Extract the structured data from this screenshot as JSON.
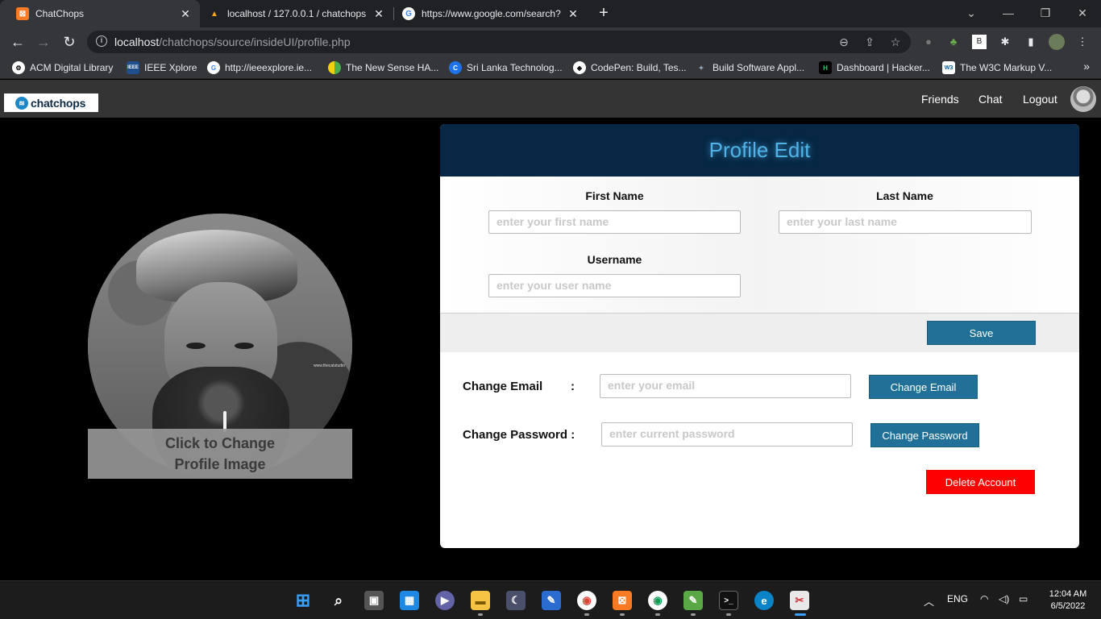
{
  "browser": {
    "tabs": [
      {
        "title": "ChatChops",
        "active": true
      },
      {
        "title": "localhost / 127.0.0.1 / chatchops",
        "active": false
      },
      {
        "title": "https://www.google.com/search?",
        "active": false
      }
    ],
    "url_host": "localhost",
    "url_path": "/chatchops/source/insideUI/profile.php",
    "bookmarks": [
      "ACM Digital Library",
      "IEEE Xplore",
      "http://ieeexplore.ie...",
      "The New Sense HA...",
      "Sri Lanka Technolog...",
      "CodePen: Build, Tes...",
      "Build Software Appl...",
      "Dashboard | Hacker...",
      "The W3C Markup V..."
    ],
    "bookmark_icon_letters": [
      "",
      "IEEE",
      "G",
      "",
      "C",
      "",
      "",
      "H",
      "W3"
    ]
  },
  "app": {
    "logo_text": "chatchops",
    "nav": {
      "friends": "Friends",
      "chat": "Chat",
      "logout": "Logout"
    },
    "profile_image_caption_line1": "Click to Change",
    "profile_image_caption_line2": "Profile Image",
    "profile_image_watermark": "www.thecatstudio",
    "card": {
      "title": "Profile Edit",
      "first_name_label": "First Name",
      "first_name_placeholder": "enter your first name",
      "last_name_label": "Last Name",
      "last_name_placeholder": "enter your last name",
      "username_label": "Username",
      "username_placeholder": "enter your user name",
      "save_label": "Save",
      "change_email_label": "Change Email",
      "change_email_colon": ":",
      "email_placeholder": "enter your email",
      "change_email_button": "Change Email",
      "change_password_label": "Change Password :",
      "password_placeholder": "enter current password",
      "change_password_button": "Change Password",
      "delete_account_button": "Delete Account"
    },
    "colors": {
      "header_bg": "#072744",
      "title": "#4fb3e8",
      "primary_button": "#207097",
      "danger_button": "#fe0000"
    }
  },
  "taskbar": {
    "language": "ENG",
    "time": "12:04 AM",
    "date": "6/5/2022"
  }
}
